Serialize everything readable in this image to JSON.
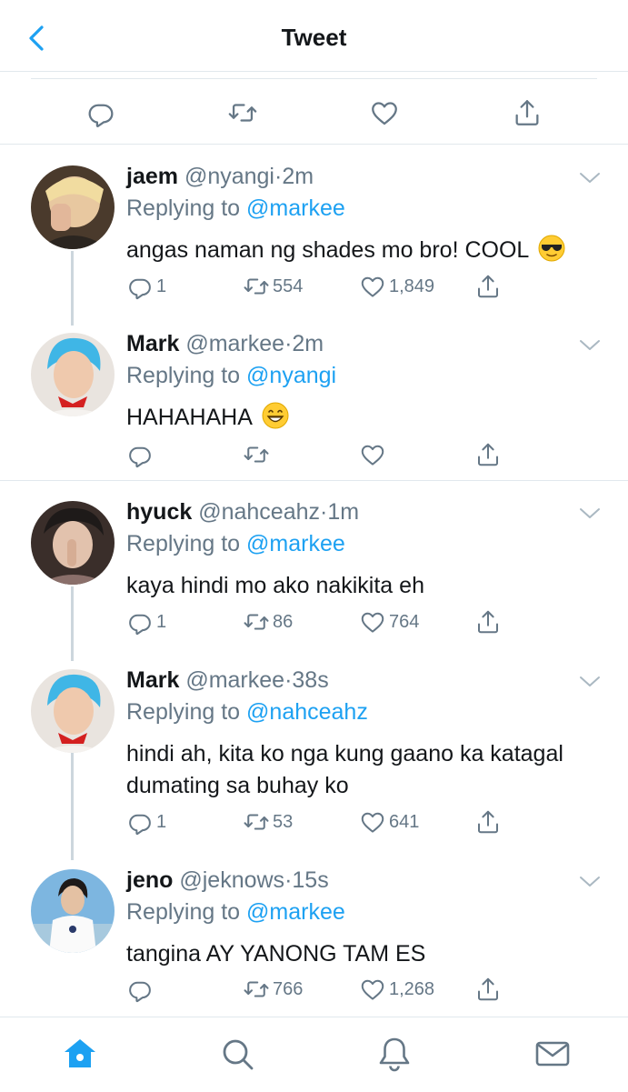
{
  "header": {
    "title": "Tweet"
  },
  "colors": {
    "accent": "#1da1f2",
    "secondary_text": "#657786",
    "primary_text": "#14171a",
    "divider": "#e1e8ed"
  },
  "tweets": [
    {
      "name": "jaem",
      "handle": "@nyangi",
      "dot": "·",
      "time": "2m",
      "replying_prefix": "Replying to",
      "replying_to": "@markee",
      "text": "angas naman ng shades mo bro! COOL",
      "emoji": "sunglasses-face",
      "replies": "1",
      "retweets": "554",
      "likes": "1,849"
    },
    {
      "name": "Mark",
      "handle": "@markee",
      "dot": "·",
      "time": "2m",
      "replying_prefix": "Replying to",
      "replying_to": "@nyangi",
      "text": "HAHAHAHA",
      "emoji": "grinning-face",
      "replies": "",
      "retweets": "",
      "likes": ""
    },
    {
      "name": "hyuck",
      "handle": "@nahceahz",
      "dot": "·",
      "time": "1m",
      "replying_prefix": "Replying to",
      "replying_to": "@markee",
      "text": "kaya hindi mo ako nakikita eh",
      "replies": "1",
      "retweets": "86",
      "likes": "764"
    },
    {
      "name": "Mark",
      "handle": "@markee",
      "dot": "·",
      "time": "38s",
      "replying_prefix": "Replying to",
      "replying_to": "@nahceahz",
      "text_line1": "hindi ah, kita ko nga kung gaano ka katagal",
      "text_line2": "dumating sa buhay ko",
      "replies": "1",
      "retweets": "53",
      "likes": "641"
    },
    {
      "name": "jeno",
      "handle": "@jeknows",
      "dot": "·",
      "time": "15s",
      "replying_prefix": "Replying to",
      "replying_to": "@markee",
      "text": "tangina AY YANONG TAM ES",
      "replies": "",
      "retweets": "766",
      "likes": "1,268"
    }
  ],
  "nav": [
    "home-icon",
    "search-icon",
    "notifications-bell-icon",
    "messages-mail-icon"
  ]
}
